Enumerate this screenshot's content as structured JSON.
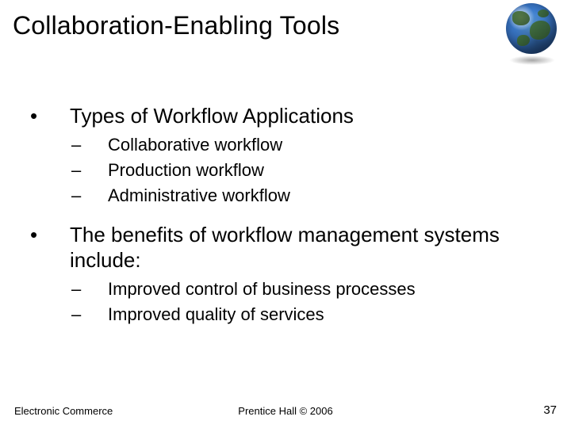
{
  "title": "Collaboration-Enabling Tools",
  "bullets": {
    "b1": {
      "mark": "•",
      "text": "Types of Workflow Applications",
      "sub": [
        {
          "dash": "–",
          "text": "Collaborative workflow"
        },
        {
          "dash": "–",
          "text": "Production workflow"
        },
        {
          "dash": "–",
          "text": "Administrative workflow"
        }
      ]
    },
    "b2": {
      "mark": "•",
      "text": "The benefits of workflow management systems include:",
      "sub": [
        {
          "dash": "–",
          "text": "Improved control of business processes"
        },
        {
          "dash": "–",
          "text": "Improved quality of services"
        }
      ]
    }
  },
  "footer": {
    "left": "Electronic Commerce",
    "center": "Prentice Hall © 2006",
    "right": "37"
  },
  "icons": {
    "globe": "globe-icon"
  }
}
